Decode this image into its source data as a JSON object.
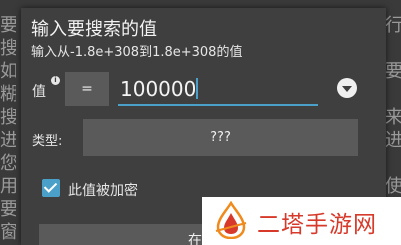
{
  "background": {
    "left_chars": [
      "要",
      "搜",
      "如",
      "糊",
      "搜",
      "进",
      "您",
      "用",
      "要",
      "窗"
    ],
    "right_chars": [
      "行",
      "",
      "要",
      "",
      "来",
      "进",
      "",
      "使",
      "",
      ""
    ]
  },
  "dialog": {
    "title": "输入要搜索的值",
    "subtitle": "输入从-1.8e+308到1.8e+308的值",
    "value_label": "值",
    "info_icon": "i",
    "operator": "=",
    "value": "100000",
    "type_label": "类型:",
    "type_value": "???",
    "encrypted_label": "此值被加密",
    "encrypted_checked": true,
    "search_all_label": "在全部"
  },
  "watermark": {
    "text": "二塔手游网"
  },
  "colors": {
    "accent": "#4aa0c8",
    "watermark_red": "#d73a2a",
    "watermark_orange": "#f08a1c"
  }
}
